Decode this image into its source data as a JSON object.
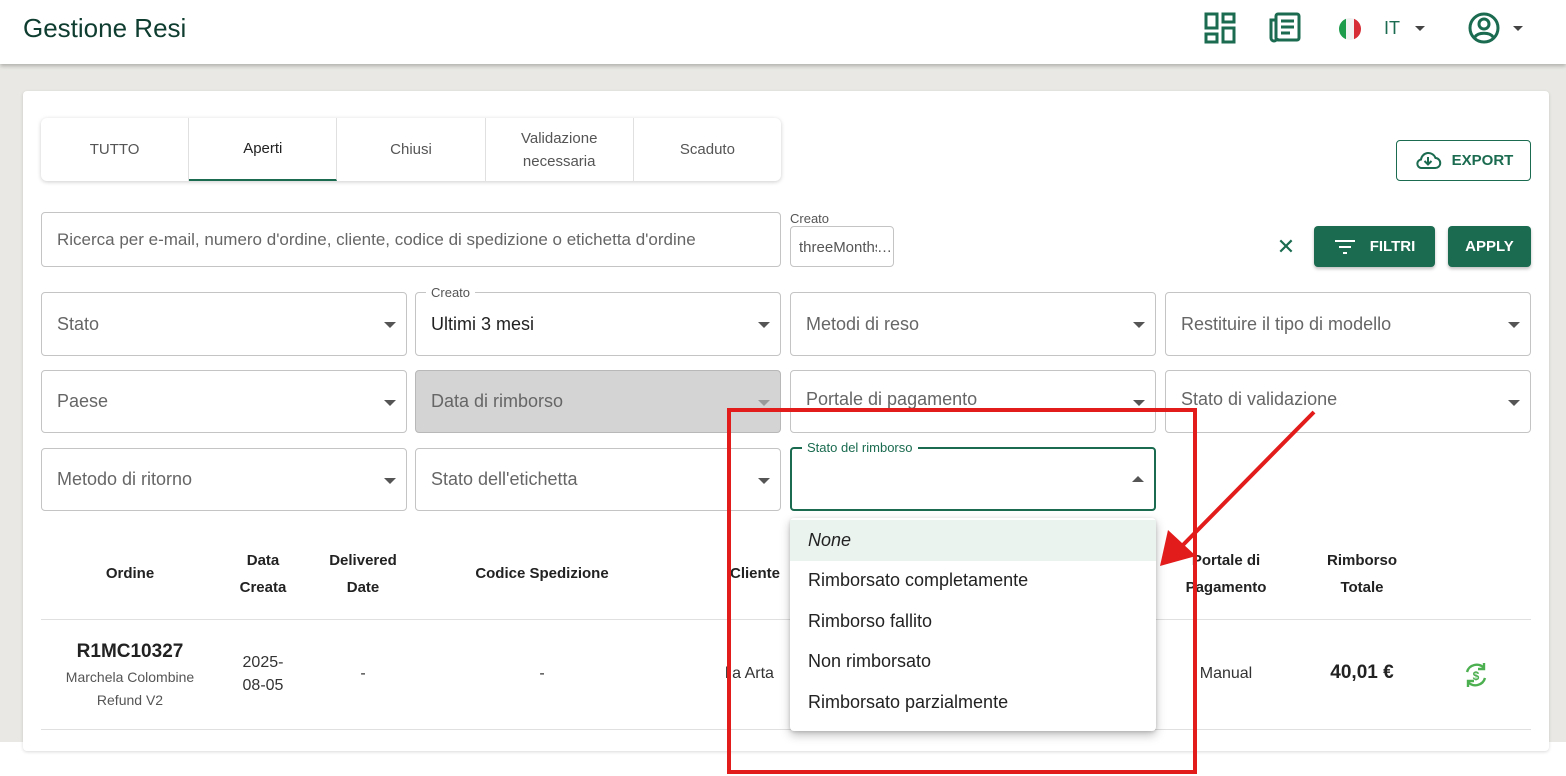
{
  "header": {
    "title": "Gestione Resi",
    "language": "IT"
  },
  "tabs": [
    {
      "label": "TUTTO",
      "active": false
    },
    {
      "label": "Aperti",
      "active": true
    },
    {
      "label": "Chiusi",
      "active": false
    },
    {
      "label": "Validazione necessaria",
      "active": false
    },
    {
      "label": "Scaduto",
      "active": false
    }
  ],
  "toolbar": {
    "export_label": "EXPORT",
    "filter_label": "FILTRI",
    "apply_label": "APPLY"
  },
  "search": {
    "placeholder": "Ricerca per e-mail, numero d'ordine, cliente, codice di spedizione o etichetta d'ordine",
    "value": ""
  },
  "created_chip": {
    "label": "Creato",
    "value": "threeMonths"
  },
  "filters": {
    "stato": "Stato",
    "creato_legend": "Creato",
    "creato_value": "Ultimi 3 mesi",
    "metodi_reso": "Metodi di reso",
    "tipo_modello": "Restituire il tipo di modello",
    "paese": "Paese",
    "data_rimborso": "Data di rimborso",
    "portale_pagamento": "Portale di pagamento",
    "stato_validazione": "Stato di validazione",
    "metodo_ritorno": "Metodo di ritorno",
    "stato_etichetta": "Stato dell'etichetta",
    "stato_rimborso_legend": "Stato del rimborso",
    "stato_rimborso_value": ""
  },
  "dropdown": {
    "options": [
      "None",
      "Rimborsato completamente",
      "Rimborso fallito",
      "Non rimborsato",
      "Rimborsato parzialmente"
    ]
  },
  "table": {
    "headers": {
      "ordine": "Ordine",
      "data_creata": "Data Creata",
      "delivered_date": "Delivered Date",
      "codice_spedizione": "Codice Spedizione",
      "cliente": "Cliente",
      "portale": "Portale di Pagamento",
      "rimborso": "Rimborso Totale"
    },
    "rows": [
      {
        "order_id": "R1MC10327",
        "order_sub1": "Marchela Colombine",
        "order_sub2": "Refund V2",
        "date_line1": "2025-",
        "date_line2": "08-05",
        "delivered": "-",
        "tracking": "-",
        "customer": "lia Arta",
        "portal": "Manual",
        "total": "40,01 €"
      }
    ]
  },
  "colors": {
    "brand": "#1a6b4f",
    "annotation": "#e21b1b"
  },
  "icons": {
    "dashboard": "dashboard-icon",
    "newspaper": "newspaper-icon",
    "account": "account-circle-icon",
    "export": "cloud-download-icon",
    "filter": "filter-list-icon",
    "refund": "currency-exchange-icon"
  }
}
